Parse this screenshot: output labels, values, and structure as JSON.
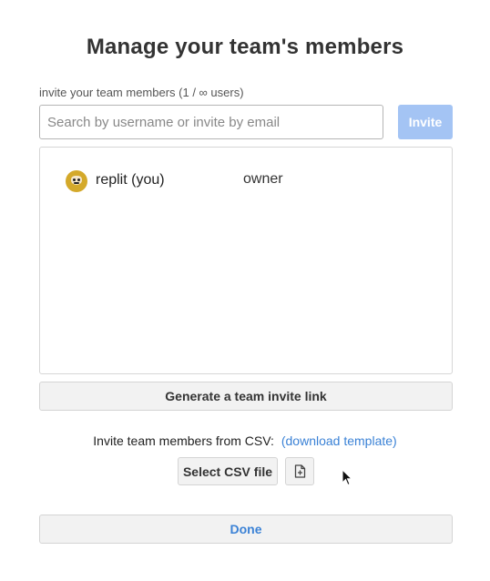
{
  "dialog": {
    "title": "Manage your team's members",
    "invite_label": "invite your team members (1 / ∞ users)"
  },
  "search": {
    "placeholder": "Search by username or invite by email",
    "value": ""
  },
  "invite_button": {
    "label": "Invite",
    "color": "#a4c4f4"
  },
  "members": [
    {
      "name": "replit (you)",
      "role": "owner",
      "avatar_icon": "replit-avatar-icon"
    }
  ],
  "generate_link_button": {
    "label": "Generate a team invite link"
  },
  "csv": {
    "text": "Invite team members from CSV:",
    "template_link": "(download template)",
    "select_button": "Select CSV file",
    "file_icon": "file-plus-icon"
  },
  "done_button": {
    "label": "Done",
    "color": "#3b82d6"
  }
}
